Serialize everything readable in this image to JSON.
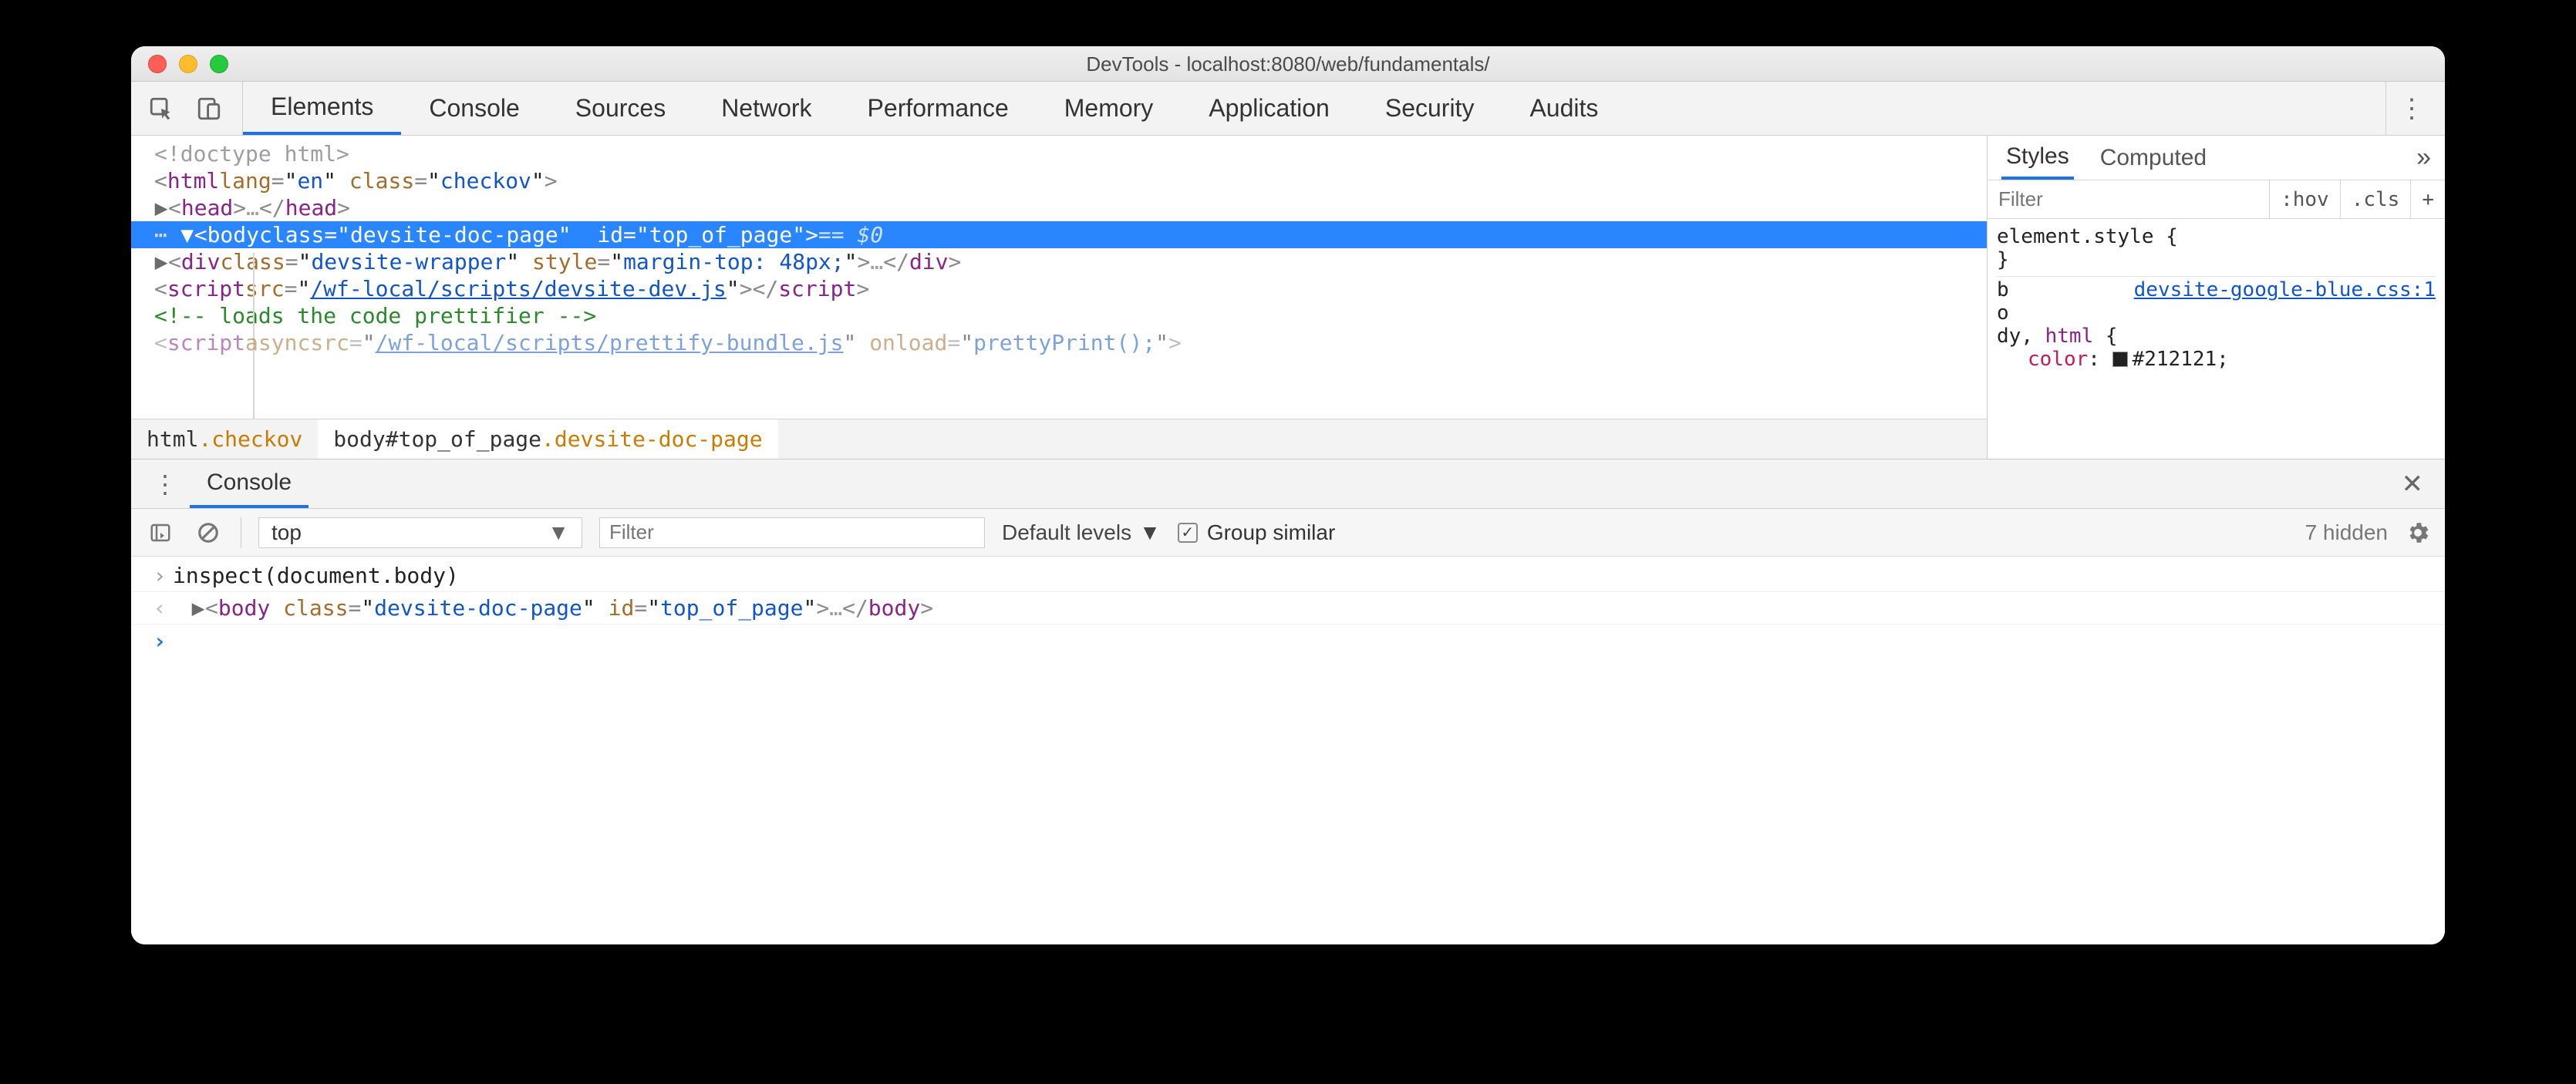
{
  "window": {
    "title": "DevTools - localhost:8080/web/fundamentals/"
  },
  "mainTabs": {
    "items": [
      "Elements",
      "Console",
      "Sources",
      "Network",
      "Performance",
      "Memory",
      "Application",
      "Security",
      "Audits"
    ],
    "activeIndex": 0
  },
  "dom": {
    "lines": {
      "doctype": "<!doctype html>",
      "htmlOpen": {
        "tag": "html",
        "attrs": [
          [
            "lang",
            "en"
          ],
          [
            "class",
            "checkov"
          ]
        ]
      },
      "head": {
        "tag": "head",
        "collapsed": true
      },
      "bodyOpen": {
        "tag": "body",
        "attrs": [
          [
            "class",
            "devsite-doc-page"
          ],
          [
            "id",
            "top_of_page"
          ]
        ],
        "selected": true,
        "hint": "== $0"
      },
      "divWrapper": {
        "tag": "div",
        "attrs": [
          [
            "class",
            "devsite-wrapper"
          ],
          [
            "style",
            "margin-top: 48px;"
          ]
        ],
        "collapsed": true
      },
      "script1": {
        "tag": "script",
        "attrs": [
          [
            "src",
            "/wf-local/scripts/devsite-dev.js"
          ]
        ]
      },
      "comment": "<!-- loads the code prettifier -->",
      "script2": {
        "tag": "script",
        "attrsRaw": "async src=\"/wf-local/scripts/prettify-bundle.js\" onload=\"prettyPrint();\">"
      }
    }
  },
  "crumbs": [
    {
      "text": "html",
      "cls": ".checkov"
    },
    {
      "text": "body#top_of_page",
      "cls": ".devsite-doc-page",
      "active": true
    }
  ],
  "styles": {
    "tabs": [
      "Styles",
      "Computed"
    ],
    "activeIndex": 0,
    "filterPlaceholder": "Filter",
    "chips": [
      ":hov",
      ".cls",
      "+"
    ],
    "elementStyle": {
      "open": "element.style {",
      "close": "}"
    },
    "rule2": {
      "prefix": "b",
      "o": "o",
      "dy": "dy",
      "src": "devsite-google-blue.css:1",
      "sel": ", html {",
      "prop": "color",
      "val": "#212121"
    }
  },
  "drawer": {
    "tabs": [
      "Console"
    ],
    "activeIndex": 0
  },
  "consoleBar": {
    "context": "top",
    "filterPlaceholder": "Filter",
    "levels": "Default levels",
    "groupSimilar": "Group similar",
    "groupChecked": true,
    "hidden": "7 hidden"
  },
  "consoleLines": {
    "in1": "inspect(document.body)",
    "out1": {
      "tag": "body",
      "attrs": [
        [
          "class",
          "devsite-doc-page"
        ],
        [
          "id",
          "top_of_page"
        ]
      ]
    }
  }
}
